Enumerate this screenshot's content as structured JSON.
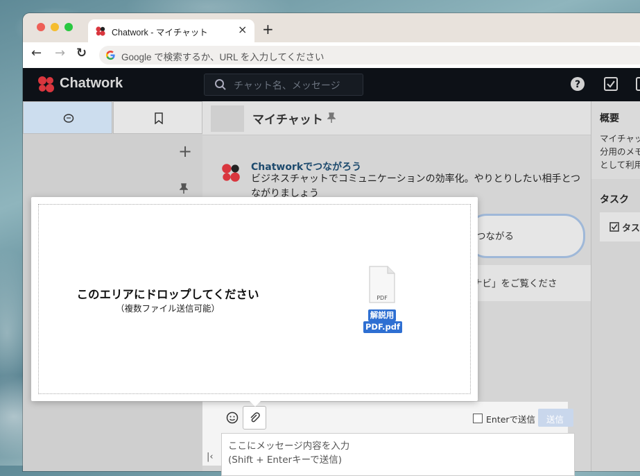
{
  "browser": {
    "tab_title": "Chatwork - マイチャット",
    "tab_close": "×",
    "new_tab": "+",
    "omnibox_placeholder": "Google で検索するか、URL を入力してください",
    "back": "←",
    "forward": "→",
    "reload": "↻"
  },
  "app": {
    "brand": "Chatwork",
    "search_placeholder": "チャット名、メッセージ",
    "add_button": "+",
    "room_name": "マイチャット",
    "sender": "Chatworkでつながろう",
    "message_line1": "ビジネスチャットでコミュニケーションの効率化。やりとりしたい相手とつ",
    "message_line2": "ながりましょう",
    "connect_button": "つながる",
    "navi_text": "ナビ」をご覧くださ",
    "right_panel": {
      "overview_title": "概要",
      "overview_line1": "マイチャッ",
      "overview_line2": "分用のメモ",
      "overview_line3": "として利用",
      "task_title": "タスク",
      "task_item": "タス"
    },
    "composer": {
      "enter_send_label": "Enterで送信",
      "send_button": "送信",
      "placeholder_line1": "ここにメッセージ内容を入力",
      "placeholder_line2": "(Shift + Enterキーで送信)"
    }
  },
  "drop_overlay": {
    "title": "このエリアにドロップしてください",
    "subtitle": "（複数ファイル送信可能）",
    "file_label_line1": "解説用",
    "file_label_line2": "PDF.pdf",
    "file_badge": "PDF"
  },
  "colors": {
    "header_bg": "#0d1117",
    "accent_red": "#d9363e",
    "file_label_bg": "#2e6fd2"
  }
}
